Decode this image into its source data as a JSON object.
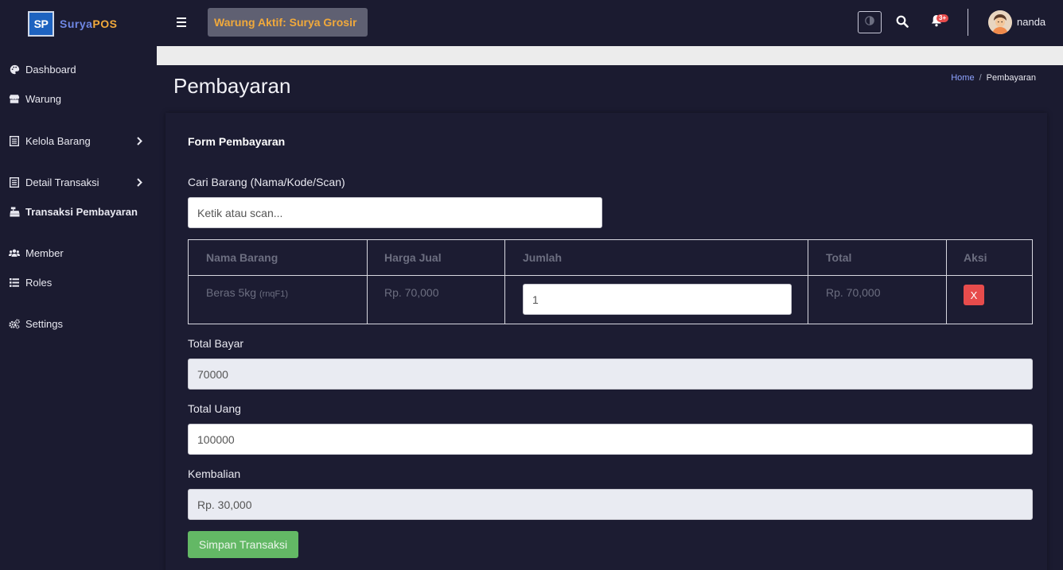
{
  "brand": {
    "logo": "SP",
    "name_part1": "Surya",
    "name_part2": "POS"
  },
  "sidebar": {
    "items": [
      {
        "label": "Dashboard",
        "icon": "palette-icon"
      },
      {
        "label": "Warung",
        "icon": "store-icon"
      },
      {
        "label": "Kelola Barang",
        "icon": "list-icon",
        "has_children": true
      },
      {
        "label": "Detail Transaksi",
        "icon": "list-icon",
        "has_children": true
      },
      {
        "label": "Transaksi Pembayaran",
        "icon": "cash-register-icon",
        "active": true
      },
      {
        "label": "Member",
        "icon": "users-icon"
      },
      {
        "label": "Roles",
        "icon": "list-icon"
      },
      {
        "label": "Settings",
        "icon": "gears-icon"
      }
    ]
  },
  "topbar": {
    "warung_label": "Warung Aktif: Surya Grosir",
    "notification_badge": "3+",
    "username": "nanda"
  },
  "header": {
    "title": "Pembayaran",
    "breadcrumb": {
      "home": "Home",
      "separator": "/",
      "current": "Pembayaran"
    }
  },
  "form": {
    "title": "Form Pembayaran",
    "search_label": "Cari Barang (Nama/Kode/Scan)",
    "search_placeholder": "Ketik atau scan...",
    "table": {
      "headers": [
        "Nama Barang",
        "Harga Jual",
        "Jumlah",
        "Total",
        "Aksi"
      ],
      "rows": [
        {
          "name": "Beras 5kg",
          "code": "(rnqF1)",
          "price": "Rp. 70,000",
          "qty": "1",
          "total": "Rp. 70,000",
          "action": "X"
        }
      ]
    },
    "total_bayar_label": "Total Bayar",
    "total_bayar_value": "70000",
    "total_uang_label": "Total Uang",
    "total_uang_value": "100000",
    "kembalian_label": "Kembalian",
    "kembalian_value": "Rp. 30,000",
    "submit_label": "Simpan Transaksi"
  },
  "colors": {
    "background": "#1b1b30",
    "brand_blue": "#6f87e4",
    "brand_orange": "#f1a93b",
    "danger": "#e74c4c",
    "success": "#63b865",
    "link": "#8fa3ff"
  }
}
